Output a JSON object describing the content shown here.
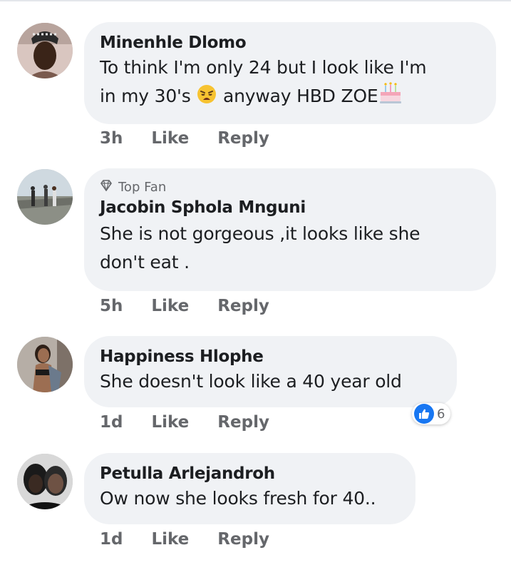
{
  "comments": [
    {
      "name": "Minenhle Dlomo",
      "text_line1": "To think I'm only 24 but I look like I'm",
      "text_line2_a": "in my 30's",
      "text_line2_b": "anyway HBD ZOE",
      "time": "3h",
      "like_label": "Like",
      "reply_label": "Reply"
    },
    {
      "badge": "Top Fan",
      "name": "Jacobin Sphola Mnguni",
      "text_line1": "She is not gorgeous ,it looks like she",
      "text_line2": "don't eat .",
      "time": "5h",
      "like_label": "Like",
      "reply_label": "Reply"
    },
    {
      "name": "Happiness Hlophe",
      "text_line1": "She doesn't  look like a 40 year old",
      "time": "1d",
      "like_label": "Like",
      "reply_label": "Reply",
      "reaction_count": "6"
    },
    {
      "name": "Petulla Arlejandroh",
      "text_line1": "Ow now she looks fresh for 40..",
      "time": "1d",
      "like_label": "Like",
      "reply_label": "Reply"
    }
  ],
  "colors": {
    "bubble": "#f0f2f5",
    "muted_text": "#65676b",
    "like_blue": "#1877f2"
  },
  "icons": [
    "weary-face-emoji",
    "birthday-cake-emoji",
    "diamond-icon",
    "thumbs-up-icon"
  ]
}
